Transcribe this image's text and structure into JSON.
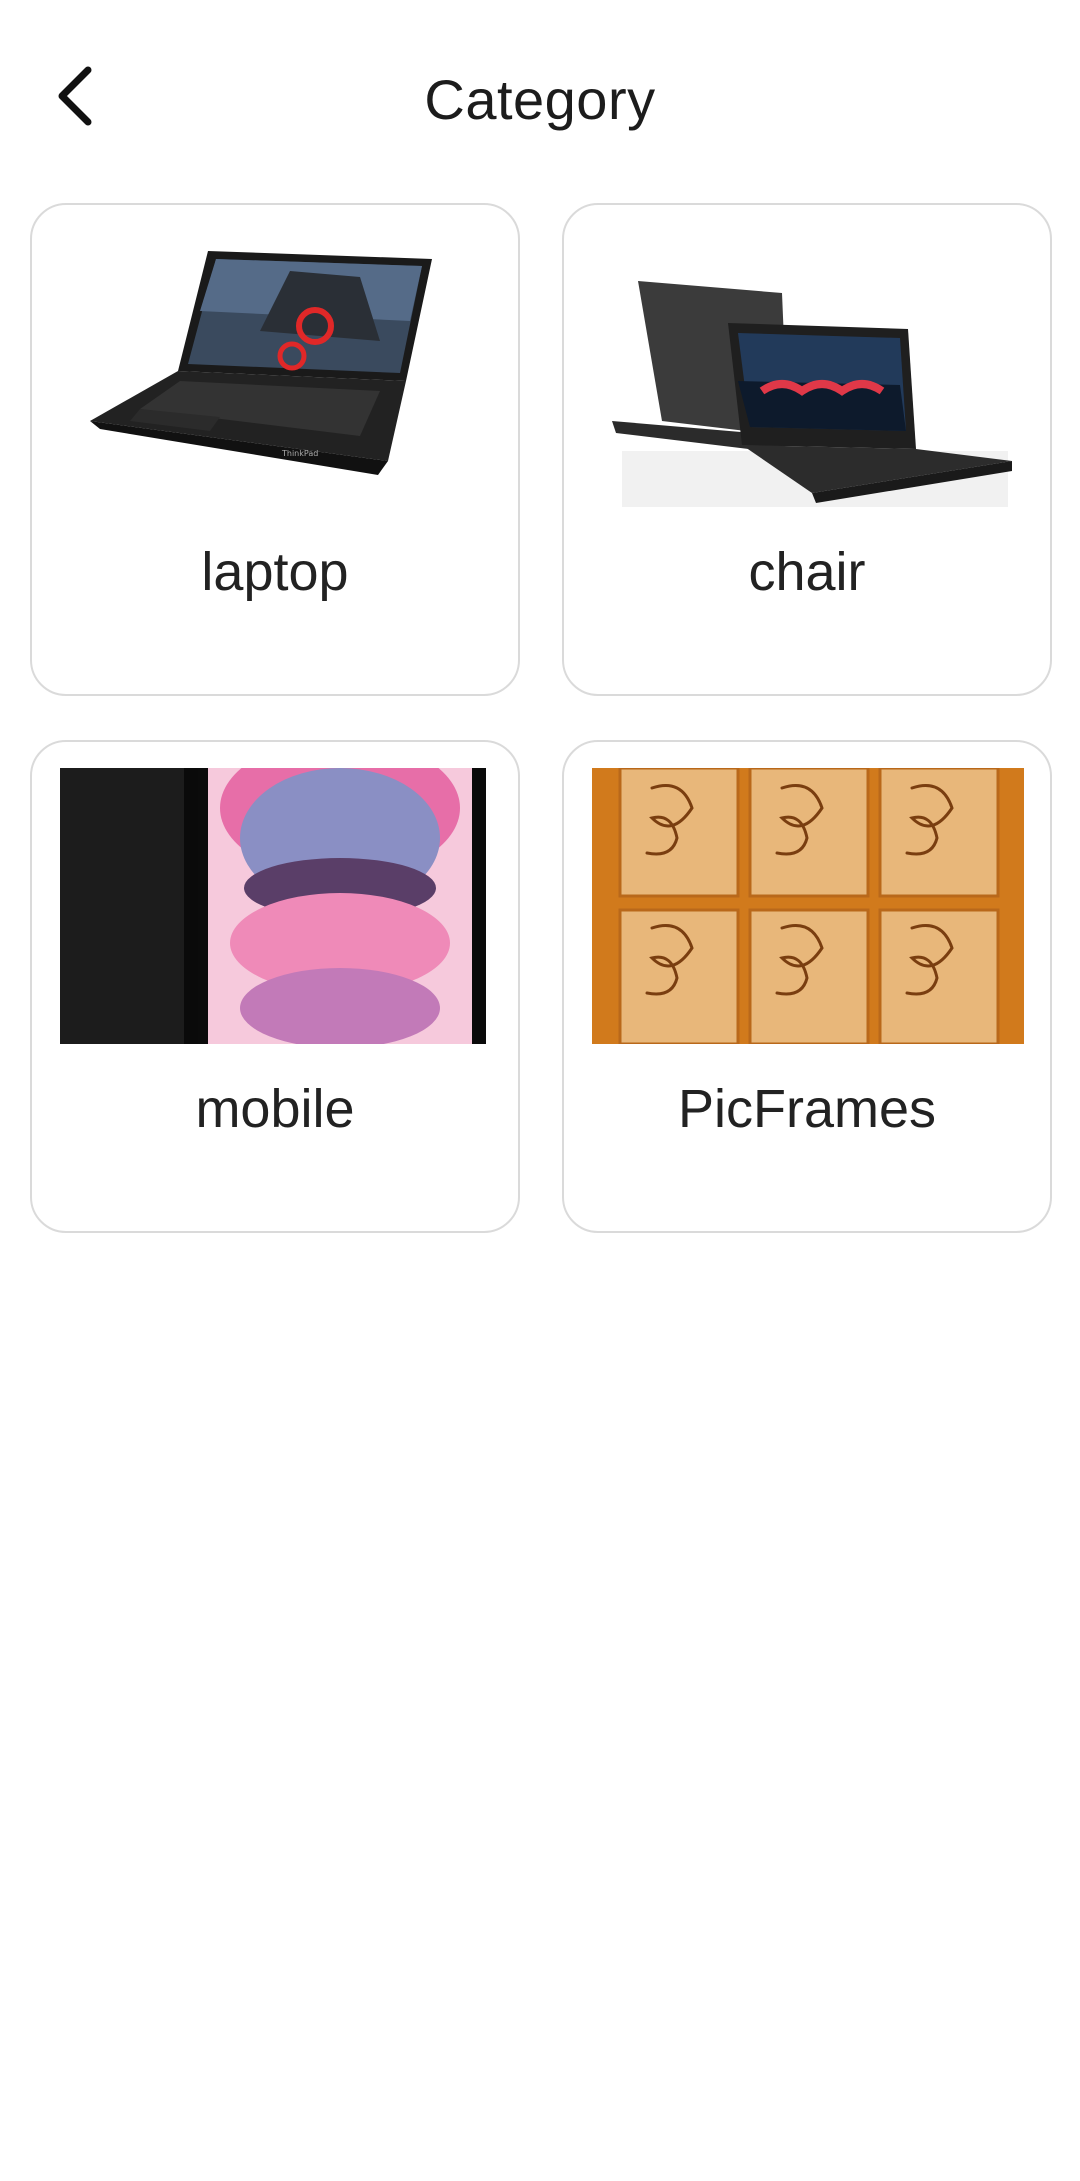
{
  "header": {
    "title": "Category",
    "back_icon": "chevron-left-icon"
  },
  "categories": [
    {
      "label": "laptop",
      "image": "laptop-image"
    },
    {
      "label": "chair",
      "image": "laptops-pair-image"
    },
    {
      "label": "mobile",
      "image": "mobile-phone-image"
    },
    {
      "label": "PicFrames",
      "image": "wood-carved-frames-image"
    }
  ],
  "colors": {
    "card_border": "#dadada",
    "text": "#1c1c1c",
    "background": "#ffffff"
  }
}
